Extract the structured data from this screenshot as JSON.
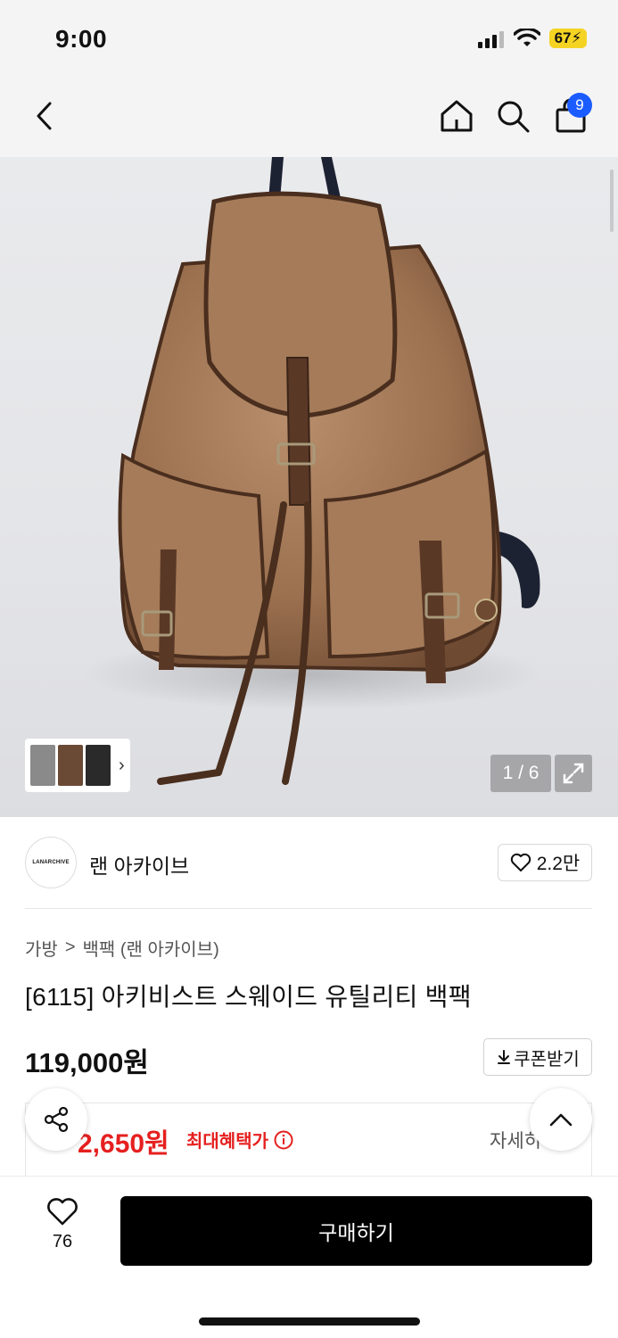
{
  "status_bar": {
    "time": "9:00",
    "battery": "67"
  },
  "nav": {
    "cart_count": "9",
    "icons": [
      "back-icon",
      "home-icon",
      "search-icon",
      "cart-icon"
    ]
  },
  "gallery": {
    "counter": "1 / 6",
    "thumb_arrow": "›"
  },
  "brand": {
    "logo_text": "LANARCHIVE",
    "name": "랜 아카이브",
    "likes": "2.2만"
  },
  "breadcrumb": {
    "category": "가방",
    "separator": ">",
    "subcategory": "백팩 (랜 아카이브)"
  },
  "product": {
    "title": "[6115] 아키비스트 스웨이드 유틸리티 백팩",
    "price": "119,000원",
    "coupon_label": "쿠폰받기"
  },
  "benefit": {
    "price": "2,650원",
    "label": "최대혜택가",
    "detail": "자세히"
  },
  "bottom": {
    "wish_count": "76",
    "buy_label": "구매하기"
  },
  "colors": {
    "accent_blue": "#1a5cff",
    "sale_red": "#e5201f",
    "buy_black": "#000000",
    "battery_yellow": "#f5d323"
  }
}
